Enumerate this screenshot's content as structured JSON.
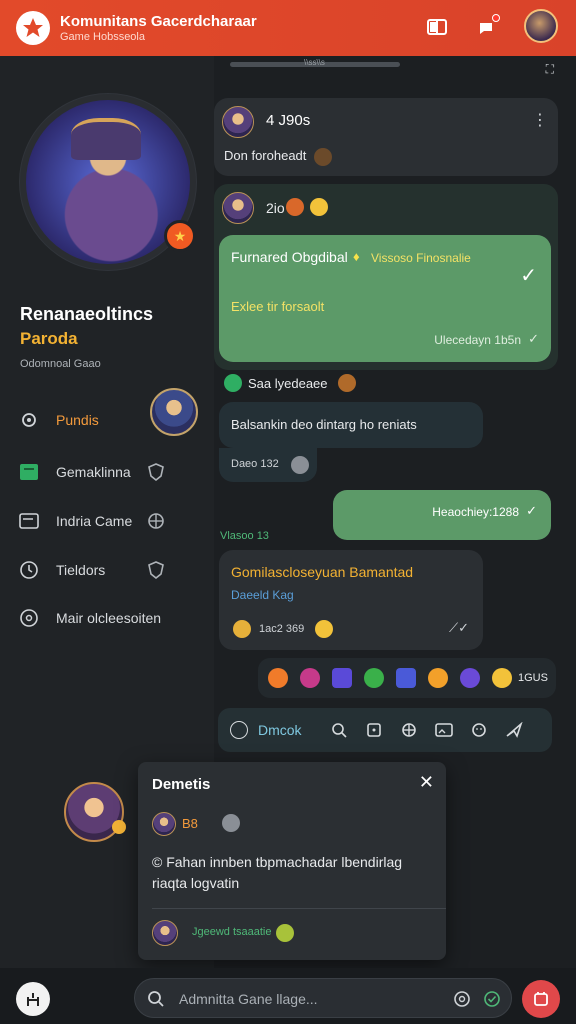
{
  "header": {
    "title": "Komunitans Gacerdcharaar",
    "subtitle": "Game Hobsseola",
    "accent": "#e24a2a"
  },
  "chat_topbar": {
    "handle_label": "\\\\ss\\\\s",
    "expand_icon": "expand-icon"
  },
  "profile": {
    "name": "Renanaeoltincs",
    "role": "Paroda",
    "sub": "Odomnoal Gaao",
    "menu": [
      {
        "label": "Pundis",
        "icon": "gear-icon"
      },
      {
        "label": "Gemaklinna",
        "icon": "chat-icon"
      },
      {
        "label": "Indria Came",
        "icon": "card-icon"
      },
      {
        "label": "Tieldors",
        "icon": "clock-icon"
      },
      {
        "label": "Mair olcleesoiten",
        "icon": "target-icon"
      }
    ]
  },
  "messages": {
    "m1": {
      "name": "4 J90s",
      "text": "Don foroheadt"
    },
    "m2": {
      "name": "2io"
    },
    "highlight": {
      "title": "Furnared Obgdibal",
      "title_tail": "Vissoso Finosnalie",
      "line2": "Exlee tir forsaolt",
      "foot": "Ulecedayn 1b5n",
      "color": "#5c9a68"
    },
    "m3": {
      "name": "Saa lyedeaee",
      "text": "Balsankin deo dintarg ho reniats",
      "time": "Daeo 132"
    },
    "sent": {
      "text": "Heaochiey:1288"
    },
    "date_label": "Vlasoo 13",
    "m4": {
      "title": "Gomilascloseyuan Bamantad",
      "sub": "Daeeld Kag",
      "time": "1ac2 369"
    },
    "reaction_count": "1GUS"
  },
  "toolbar": {
    "label": "Dmcok"
  },
  "popup": {
    "title": "Demetis",
    "count": "B8",
    "body_line1": "Fahan innben tbpmachadar lbendirlag",
    "body_line2": "riaqta logvatin",
    "footer_text": "Jgeewd tsaaatie"
  },
  "input": {
    "placeholder": "Admnitta Gane llage..."
  }
}
